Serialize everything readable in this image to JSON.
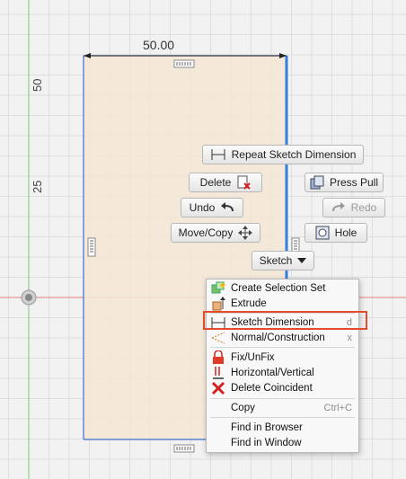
{
  "sketch": {
    "horizontal_dimension": "50.00",
    "axis_labels": [
      "50",
      "25"
    ]
  },
  "marking_menu": {
    "repeat": "Repeat Sketch Dimension",
    "delete": "Delete",
    "press_pull": "Press Pull",
    "undo": "Undo",
    "redo": "Redo",
    "move_copy": "Move/Copy",
    "hole": "Hole",
    "sketch": "Sketch"
  },
  "context_menu": {
    "items": [
      {
        "label": "Create Selection Set",
        "shortcut": ""
      },
      {
        "label": "Extrude",
        "shortcut": ""
      },
      {
        "label": "Sketch Dimension",
        "shortcut": "d"
      },
      {
        "label": "Normal/Construction",
        "shortcut": "x"
      },
      {
        "label": "Fix/UnFix",
        "shortcut": ""
      },
      {
        "label": "Horizontal/Vertical",
        "shortcut": ""
      },
      {
        "label": "Delete Coincident",
        "shortcut": ""
      },
      {
        "label": "Copy",
        "shortcut": "Ctrl+C"
      },
      {
        "label": "Find in Browser",
        "shortcut": ""
      },
      {
        "label": "Find in Window",
        "shortcut": ""
      }
    ]
  },
  "colors": {
    "sketch_fill": "#f5e6d5",
    "selected_line": "#2f7fe0",
    "highlight_box": "#e24b2c",
    "y_axis": "#7fc77f",
    "x_axis": "#e38080"
  }
}
